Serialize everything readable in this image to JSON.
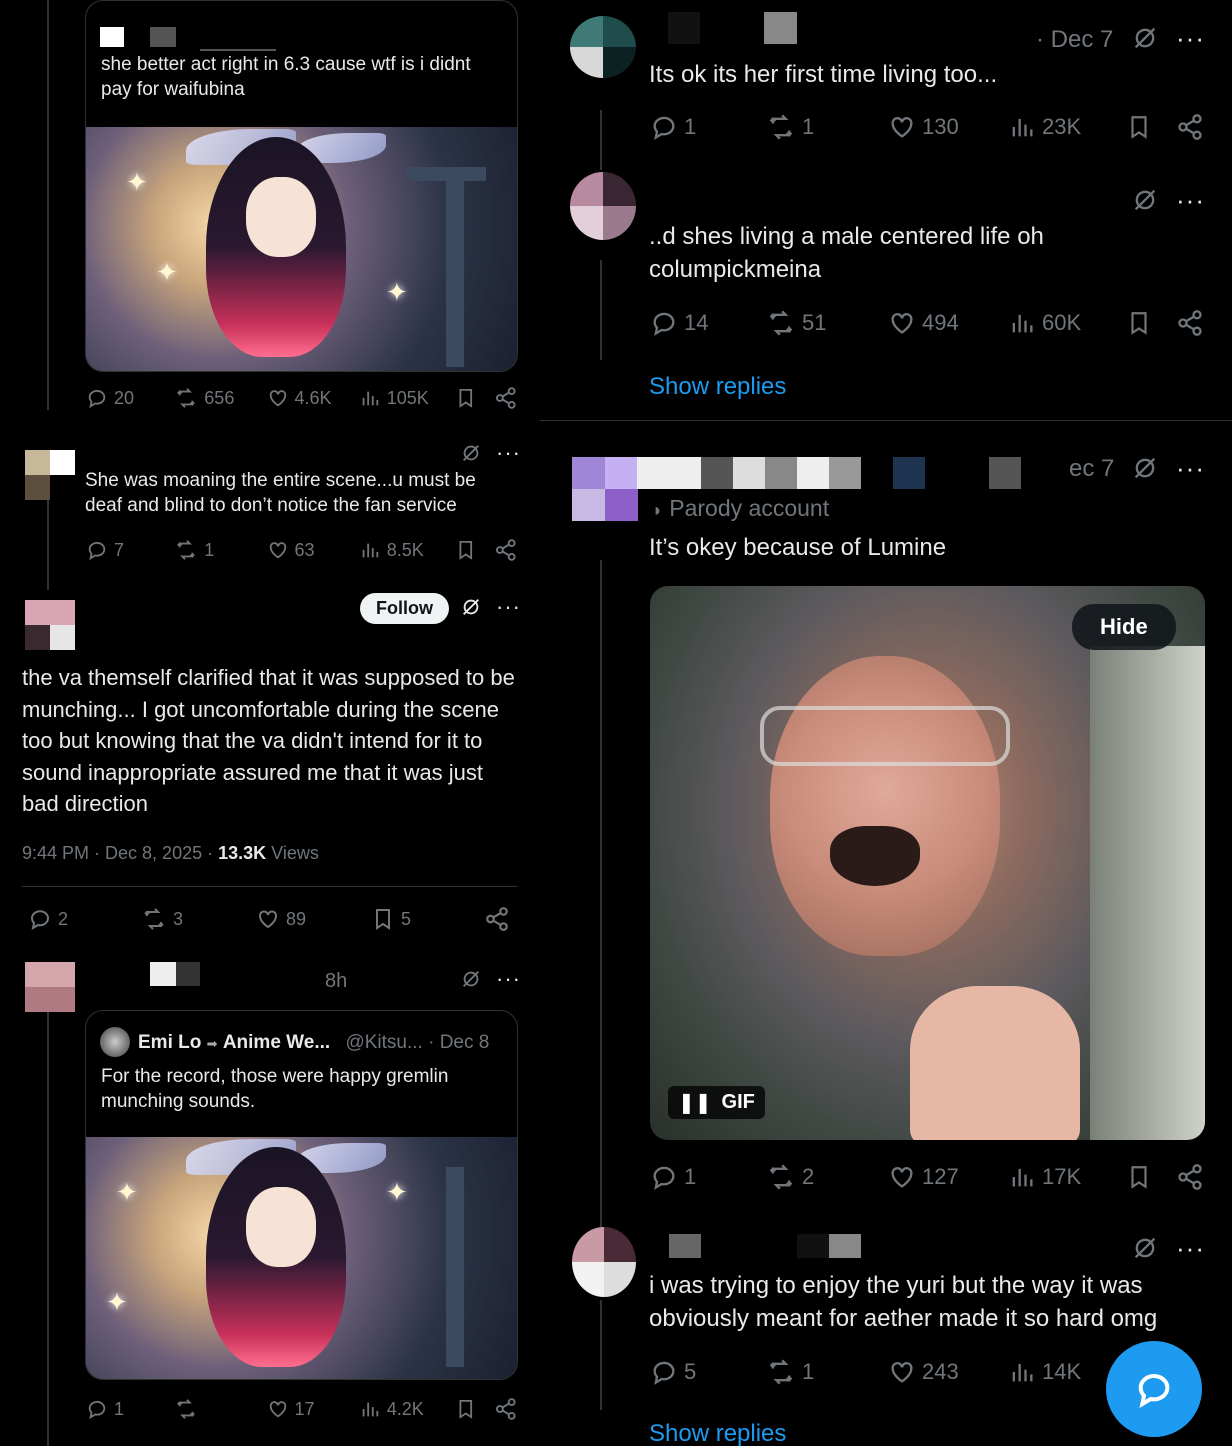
{
  "left": {
    "post1": {
      "text": "she better act right in 6.3 cause wtf is i didnt pay for waifubina",
      "stats": {
        "replies": "20",
        "reposts": "656",
        "likes": "4.6K",
        "views": "105K"
      }
    },
    "post2": {
      "text": "She was moaning the entire scene...u must be deaf and blind to don’t notice the fan service",
      "stats": {
        "replies": "7",
        "reposts": "1",
        "likes": "63",
        "views": "8.5K"
      }
    },
    "post3": {
      "follow_label": "Follow",
      "text": "the va themself clarified that it was supposed to be munching... I got uncomfortable during the scene too but knowing that the va didn't intend for it to sound inappropriate assured me that it was just bad direction",
      "timestamp": "9:44 PM · Dec 8, 2025 · ",
      "views_count": "13.3K",
      "views_label": " Views",
      "stats": {
        "replies": "2",
        "reposts": "3",
        "likes": "89",
        "bookmarks": "5"
      }
    },
    "post4": {
      "time": "8h",
      "quote": {
        "name1": "Emi Lo",
        "name2": "Anime We...",
        "handle": "@Kitsu...",
        "date": "· Dec 8",
        "text": "For the record, those were happy gremlin munching sounds."
      },
      "stats": {
        "replies": "1",
        "reposts": "",
        "likes": "17",
        "views": "4.2K"
      }
    }
  },
  "right": {
    "reply1": {
      "date": "· Dec 7",
      "text": "Its ok its her first time living too...",
      "stats": {
        "replies": "1",
        "reposts": "1",
        "likes": "130",
        "views": "23K"
      }
    },
    "reply2": {
      "text": "..d shes living a male centered life oh columpickmeina",
      "stats": {
        "replies": "14",
        "reposts": "51",
        "likes": "494",
        "views": "60K"
      }
    },
    "show_replies_1": "Show replies",
    "reply3": {
      "date": "ec 7",
      "parody": "Parody account",
      "text": "It’s okey because of Lumine",
      "hide_label": "Hide",
      "gif_label": "GIF",
      "stats": {
        "replies": "1",
        "reposts": "2",
        "likes": "127",
        "views": "17K"
      }
    },
    "reply4": {
      "text": "i was trying to enjoy the yuri but the way it was obviously meant for aether made it so hard omg",
      "stats": {
        "replies": "5",
        "reposts": "1",
        "likes": "243",
        "views": "14K"
      }
    },
    "show_replies_2": "Show replies"
  },
  "colors": {
    "accent": "#1d9bf0",
    "bg": "#000000",
    "muted": "#71767b",
    "text": "#e7e9ea"
  }
}
